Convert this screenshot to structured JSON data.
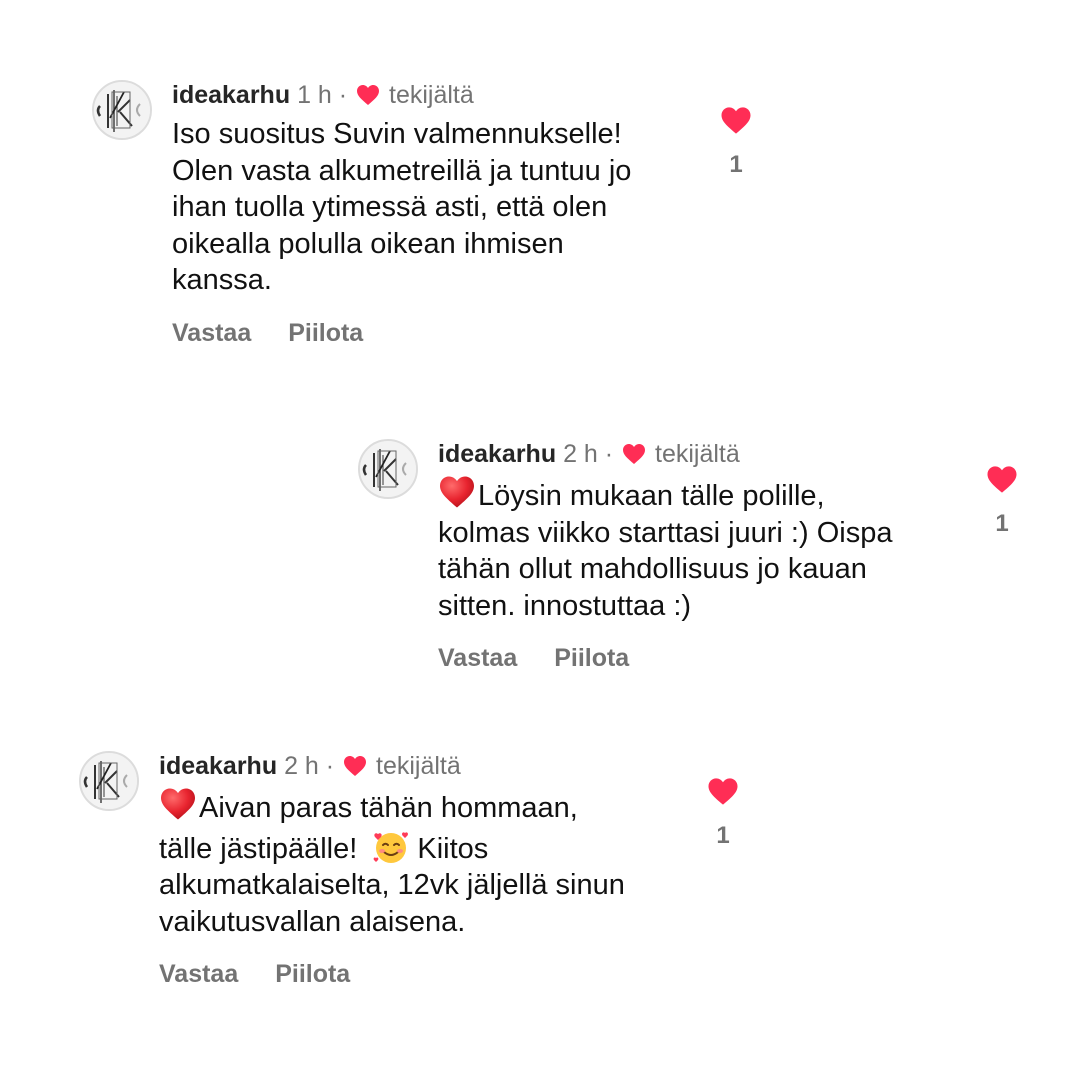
{
  "colors": {
    "like_red": "#ff2d55",
    "muted": "#737373",
    "text": "#111111"
  },
  "comments": [
    {
      "username": "ideakarhu",
      "time": "1 h",
      "dot": "·",
      "author_label": "tekijältä",
      "lines": [
        "Iso suositus Suvin valmennukselle!",
        "Olen vasta alkumetreillä ja tuntuu jo",
        "ihan tuolla ytimessä asti, että olen",
        "oikealla polulla oikean ihmisen",
        "kanssa."
      ],
      "reply_label": "Vastaa",
      "hide_label": "Piilota",
      "likes": "1",
      "icons": {
        "avatar": "profile-avatar",
        "like": "heart-icon"
      }
    },
    {
      "username": "ideakarhu",
      "time": "2 h",
      "dot": "·",
      "author_label": "tekijältä",
      "lines": [
        "Löysin mukaan tälle polille,",
        "kolmas viikko starttasi juuri :) Oispa",
        "tähän ollut mahdollisuus jo kauan",
        "sitten. innostuttaa :)"
      ],
      "reply_label": "Vastaa",
      "hide_label": "Piilota",
      "likes": "1",
      "icons": {
        "lead_emoji": "red-heart-emoji",
        "like": "heart-icon"
      }
    },
    {
      "username": "ideakarhu",
      "time": "2 h",
      "dot": "·",
      "author_label": "tekijältä",
      "lines": [
        "Aivan paras tähän hommaan,",
        "tälle jästipäälle!",
        "Kiitos",
        "alkumatkalaiselta, 12vk jäljellä sinun",
        "vaikutusvallan alaisena."
      ],
      "reply_label": "Vastaa",
      "hide_label": "Piilota",
      "likes": "1",
      "icons": {
        "lead_emoji": "red-heart-emoji",
        "inline_emoji": "smiling-face-with-hearts-emoji",
        "like": "heart-icon"
      }
    }
  ]
}
